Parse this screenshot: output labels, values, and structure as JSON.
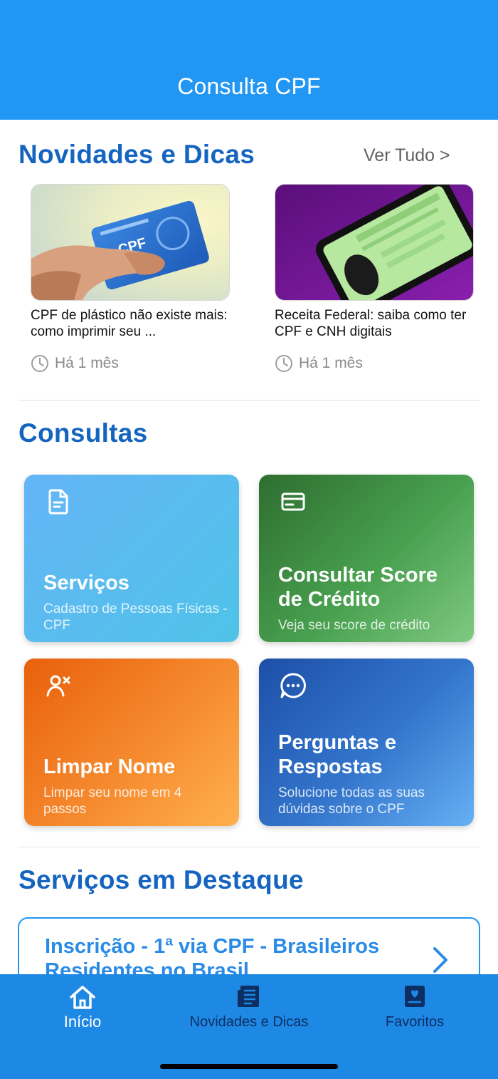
{
  "header": {
    "title": "Consulta CPF"
  },
  "news": {
    "title": "Novidades e Dicas",
    "see_all": "Ver Tudo >",
    "items": [
      {
        "title": "CPF de plástico não existe mais: como imprimir seu ...",
        "time": "Há 1 mês",
        "image": "hand-holding-cpf-card-photo"
      },
      {
        "title": "Receita Federal: saiba como ter CPF e CNH digitais",
        "time": "Há 1 mês",
        "image": "phone-with-digital-cnh-photo"
      }
    ]
  },
  "consultas": {
    "title": "Consultas",
    "tiles": [
      {
        "title": "Serviços",
        "subtitle": "Cadastro de Pessoas Físicas - CPF",
        "icon": "document-icon"
      },
      {
        "title": "Consultar Score de Crédito",
        "subtitle": "Veja seu score de crédito",
        "icon": "credit-card-icon"
      },
      {
        "title": "Limpar Nome",
        "subtitle": "Limpar seu nome em 4 passos",
        "icon": "person-remove-icon"
      },
      {
        "title": "Perguntas e Respostas",
        "subtitle": "Solucione todas as suas dúvidas sobre o CPF",
        "icon": "chat-bubble-icon"
      }
    ]
  },
  "featured": {
    "title": "Serviços em Destaque",
    "items": [
      {
        "label": "Inscrição - 1ª via CPF - Brasileiros Residentes no Brasil"
      }
    ]
  },
  "bottom_nav": {
    "items": [
      {
        "label": "Início",
        "icon": "home-icon",
        "active": true
      },
      {
        "label": "Novidades e Dicas",
        "icon": "news-icon",
        "active": false
      },
      {
        "label": "Favoritos",
        "icon": "favorites-icon",
        "active": false
      }
    ]
  },
  "colors": {
    "primary": "#2196f3",
    "heading": "#1565c0",
    "nav_background": "#1e88e5",
    "nav_inactive": "#0d2f63"
  }
}
